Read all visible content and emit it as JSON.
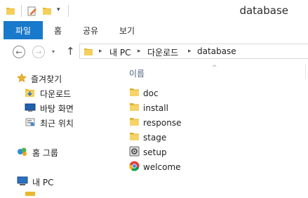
{
  "window": {
    "title": "database"
  },
  "ribbon": {
    "tabs": [
      "파일",
      "홈",
      "공유",
      "보기"
    ]
  },
  "address": {
    "crumbs": [
      "내 PC",
      "다운로드",
      "database"
    ]
  },
  "nav": {
    "favorites_label": "즐겨찾기",
    "favorites": [
      "다운로드",
      "바탕 화면",
      "최근 위치"
    ],
    "homegroup": "홈 그룹",
    "thispc": "내 PC"
  },
  "content": {
    "column_name": "이름",
    "files": [
      {
        "name": "doc",
        "icon": "folder-icon"
      },
      {
        "name": "install",
        "icon": "folder-icon"
      },
      {
        "name": "response",
        "icon": "folder-icon"
      },
      {
        "name": "stage",
        "icon": "folder-icon"
      },
      {
        "name": "setup",
        "icon": "setup-app-icon"
      },
      {
        "name": "welcome",
        "icon": "chrome-icon"
      }
    ]
  },
  "colors": {
    "accent": "#1979ca",
    "folder": "#e8b92f"
  }
}
